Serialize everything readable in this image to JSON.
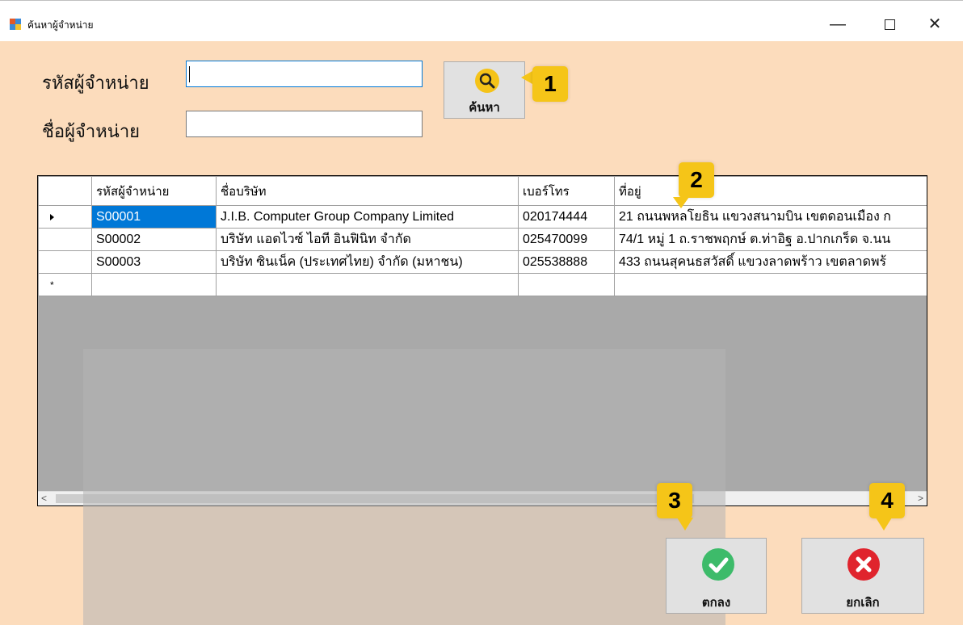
{
  "window": {
    "title": "ค้นหาผู้จำหน่าย",
    "minimize": "—",
    "close": "✕"
  },
  "form": {
    "code_label": "รหัสผู้จำหน่าย",
    "code_value": "",
    "name_label": "ชื่อผู้จำหน่าย",
    "name_value": "",
    "search_label": "ค้นหา"
  },
  "callouts": [
    "1",
    "2",
    "3",
    "4"
  ],
  "grid": {
    "columns": [
      "รหัสผู้จำหน่าย",
      "ชื่อบริษัท",
      "เบอร์โทร",
      "ที่อยู่"
    ],
    "rows": [
      [
        "S00001",
        "J.I.B. Computer Group Company Limited",
        "020174444",
        "21 ถนนพหลโยธิน แขวงสนามบิน เขตดอนเมือง ก"
      ],
      [
        "S00002",
        "บริษัท แอดไวซ์ ไอที อินฟินิท จำกัด",
        "025470099",
        "74/1 หมู่ 1 ถ.ราชพฤกษ์ ต.ท่าอิฐ อ.ปากเกร็ด จ.นน"
      ],
      [
        "S00003",
        "บริษัท ซินเน็ค (ประเทศไทย) จำกัด (มหาชน)",
        "025538888",
        "433 ถนนสุคนธสวัสดิ์ แขวงลาดพร้าว เขตลาดพร้"
      ]
    ],
    "new_row_marker": "*",
    "scroll_left": "<",
    "scroll_right": ">"
  },
  "buttons": {
    "ok_label": "ตกลง",
    "cancel_label": "ยกเลิก"
  },
  "colors": {
    "background": "#fcdcbc",
    "selection": "#0078d7",
    "callout": "#f5c518",
    "ok_icon": "#3dbb6a",
    "cancel_icon": "#e0242d"
  }
}
